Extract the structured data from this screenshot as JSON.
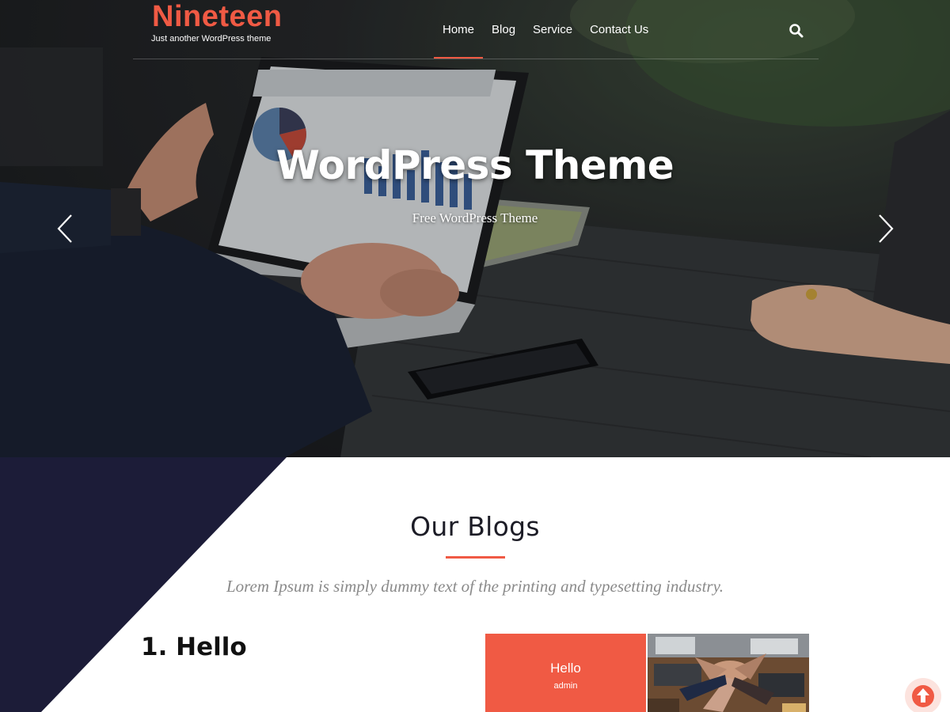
{
  "site": {
    "title": "Nineteen",
    "tagline": "Just another WordPress theme",
    "accent_color": "#f05a44",
    "dark_color": "#1c1c38"
  },
  "nav": {
    "items": [
      {
        "label": "Home",
        "active": true
      },
      {
        "label": "Blog",
        "active": false
      },
      {
        "label": "Service",
        "active": false
      },
      {
        "label": "Contact Us",
        "active": false
      }
    ],
    "search_icon": "search-icon"
  },
  "slider": {
    "title": "WordPress Theme",
    "subtitle": "Free WordPress Theme",
    "prev_icon": "chevron-left-icon",
    "next_icon": "chevron-right-icon"
  },
  "blogs": {
    "title": "Our Blogs",
    "description": "Lorem Ipsum is simply dummy text of the printing and typesetting industry.",
    "post_heading": "1. Hello",
    "card": {
      "title": "Hello",
      "author": "admin"
    }
  },
  "scroll_top_icon": "arrow-up-icon"
}
